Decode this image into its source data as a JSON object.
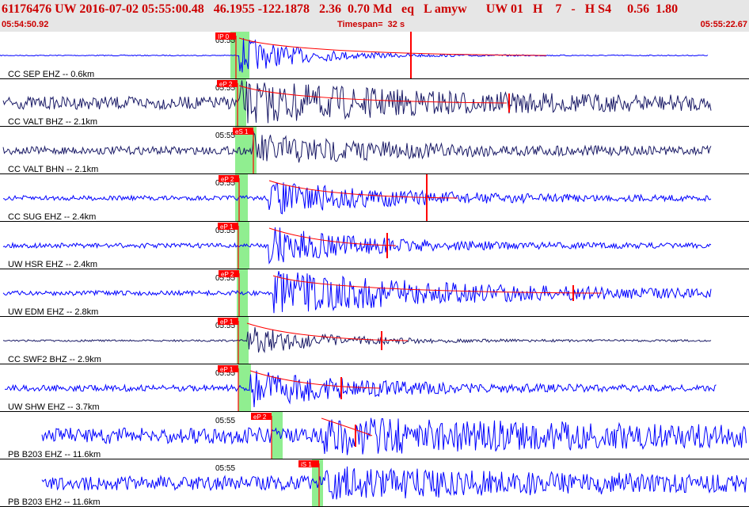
{
  "header": {
    "title": "61176476 UW 2016-07-02 05:55:00.48   46.1955 -122.1878   2.36  0.70 Md   eq   L amyw      UW 01   H    7   -   H S4     0.56  1.80",
    "start_time": "05:54:50.92",
    "timespan": "Timespan=  32 s",
    "end_time": "05:55:22.67"
  },
  "colors": {
    "header_bg": "#e6e6e6",
    "header_text": "#cc0000",
    "pick": "#ff0000",
    "window": "#90ee90",
    "trace_blue": "#0000ff",
    "trace_navy": "#1a1a66"
  },
  "panels": [
    {
      "label": "CC SEP EHZ -- 0.6km",
      "time_label": "05:55",
      "pick_text": "IP 0",
      "color": "blue"
    },
    {
      "label": "CC VALT BHZ -- 2.1km",
      "time_label": "05:55",
      "pick_text": "eP 2",
      "color": "navy"
    },
    {
      "label": "CC VALT BHN -- 2.1km",
      "time_label": "05:55",
      "pick_text": "eS 1",
      "color": "navy"
    },
    {
      "label": "CC SUG EHZ -- 2.4km",
      "time_label": "05:55",
      "pick_text": "eP 2",
      "color": "blue"
    },
    {
      "label": "UW HSR EHZ -- 2.4km",
      "time_label": "05:55",
      "pick_text": "eP 1",
      "color": "blue"
    },
    {
      "label": "UW EDM EHZ -- 2.8km",
      "time_label": "05:55",
      "pick_text": "eP 2",
      "color": "blue"
    },
    {
      "label": "CC SWF2 BHZ -- 2.9km",
      "time_label": "05:55",
      "pick_text": "eP 1",
      "color": "navy"
    },
    {
      "label": "UW SHW EHZ -- 3.7km",
      "time_label": "05:55",
      "pick_text": "eP 1",
      "color": "blue"
    },
    {
      "label": "PB B203 EHZ -- 11.6km",
      "time_label": "05:55",
      "pick_text": "eP 2",
      "color": "blue"
    },
    {
      "label": "PB B203 EH2 -- 11.6km",
      "time_label": "05:55",
      "pick_text": "iS 1",
      "color": "blue"
    }
  ]
}
